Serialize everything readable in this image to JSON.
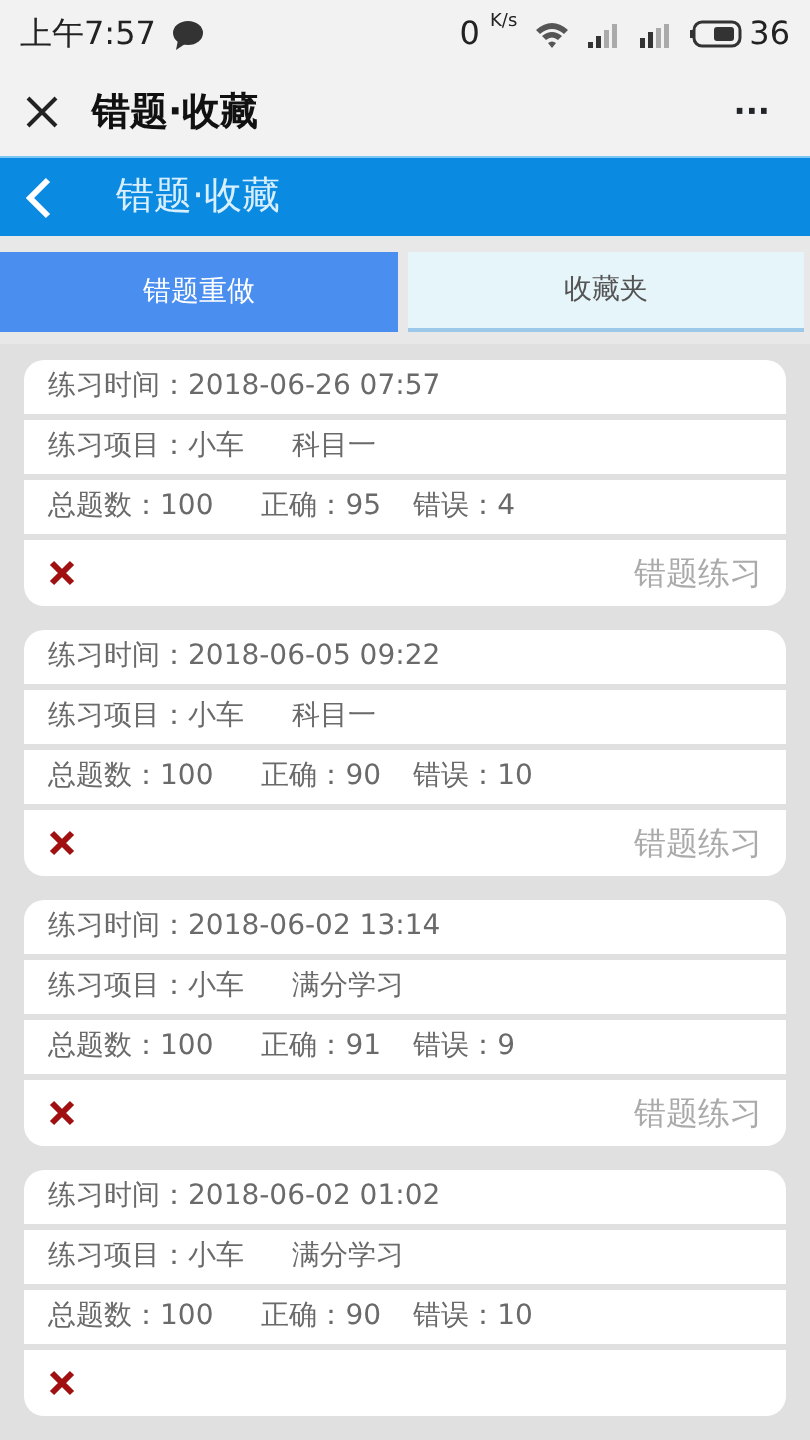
{
  "status_bar": {
    "time": "上午7:57",
    "speed": "0",
    "speed_unit": "K/s",
    "battery": "36"
  },
  "app_bar": {
    "title": "错题·收藏",
    "more": "···"
  },
  "header": {
    "title": "错题·收藏"
  },
  "tabs": [
    {
      "label": "错题重做",
      "selected": true
    },
    {
      "label": "收藏夹",
      "selected": false
    }
  ],
  "records": [
    {
      "time": "练习时间：2018-06-26 07:57",
      "project": "练习项目：小车",
      "subject": "科目一",
      "total": "总题数：100",
      "correct": "正确：95",
      "wrong": "错误：4",
      "action": "错题练习"
    },
    {
      "time": "练习时间：2018-06-05 09:22",
      "project": "练习项目：小车",
      "subject": "科目一",
      "total": "总题数：100",
      "correct": "正确：90",
      "wrong": "错误：10",
      "action": "错题练习"
    },
    {
      "time": "练习时间：2018-06-02 13:14",
      "project": "练习项目：小车",
      "subject": "满分学习",
      "total": "总题数：100",
      "correct": "正确：91",
      "wrong": "错误：9",
      "action": "错题练习"
    },
    {
      "time": "练习时间：2018-06-02 01:02",
      "project": "练习项目：小车",
      "subject": "满分学习",
      "total": "总题数：100",
      "correct": "正确：90",
      "wrong": "错误：10"
    }
  ]
}
